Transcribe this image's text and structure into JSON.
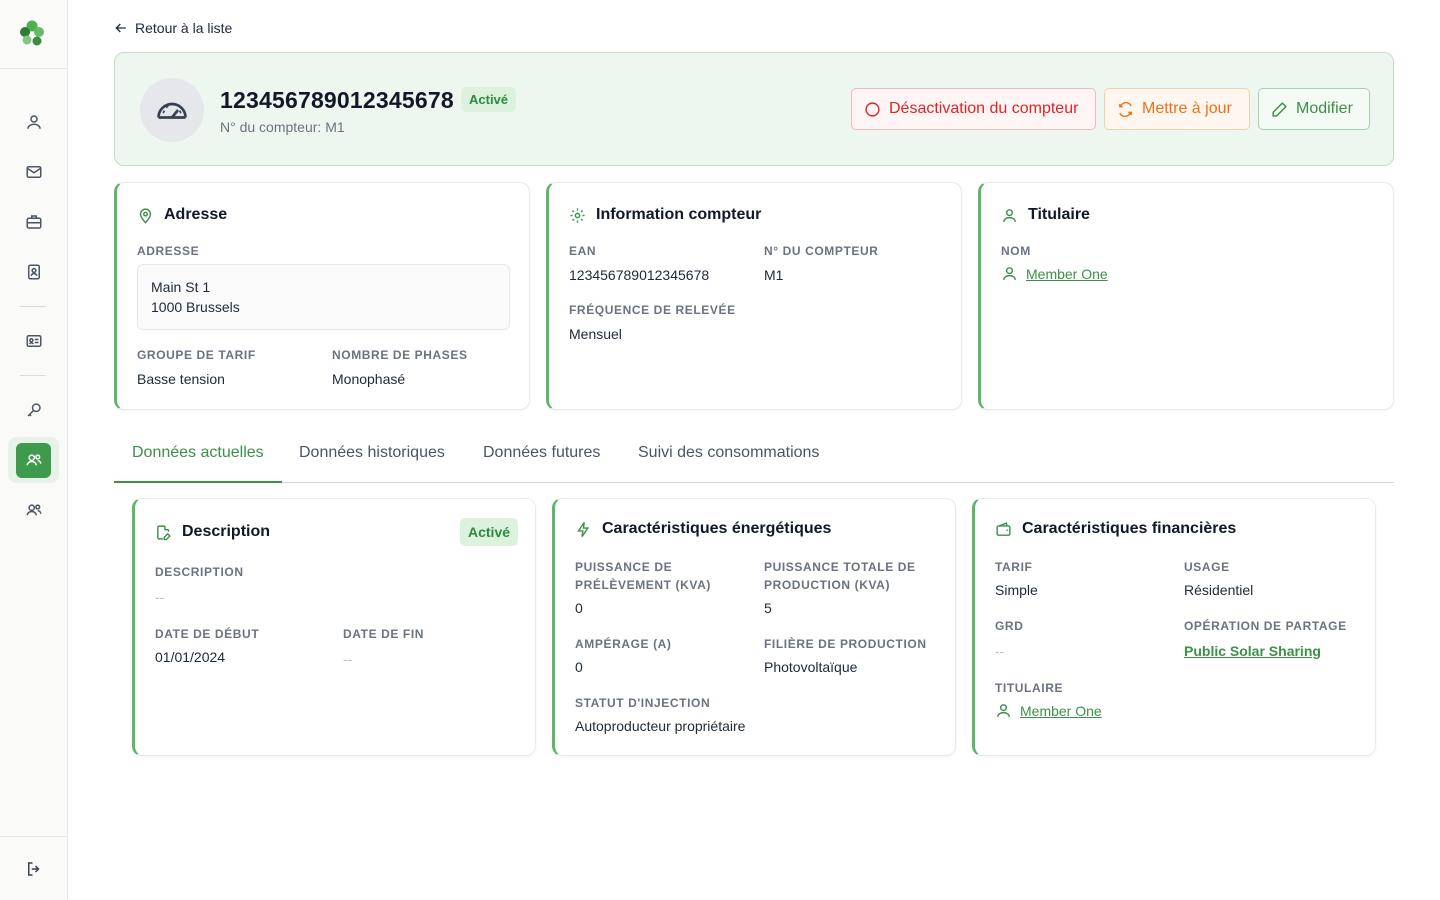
{
  "header": {
    "back_label": "Retour à la liste",
    "meter_id": "123456789012345678",
    "status_badge": "Activé",
    "subtitle": "N° du compteur: M1",
    "deactivate_label": "Désactivation du compteur",
    "update_label": "Mettre à jour",
    "edit_label": "Modifier"
  },
  "address_card": {
    "title": "Adresse",
    "address_label": "ADRESSE",
    "address_line1": "Main St 1",
    "address_line2": "1000 Brussels",
    "tariff_group_label": "GROUPE DE TARIF",
    "tariff_group_value": "Basse tension",
    "phases_label": "NOMBRE DE PHASES",
    "phases_value": "Monophasé"
  },
  "meter_card": {
    "title": "Information compteur",
    "ean_label": "EAN",
    "ean_value": "123456789012345678",
    "meter_no_label": "N° DU COMPTEUR",
    "meter_no_value": "M1",
    "frequency_label": "FRÉQUENCE DE RELEVÉE",
    "frequency_value": "Mensuel"
  },
  "holder_card": {
    "title": "Titulaire",
    "name_label": "NOM",
    "name_value": "Member One"
  },
  "tabs": [
    {
      "label": "Données actuelles"
    },
    {
      "label": "Données historiques"
    },
    {
      "label": "Données futures"
    },
    {
      "label": "Suivi des consommations"
    }
  ],
  "description_card": {
    "title": "Description",
    "badge": "Activé",
    "description_label": "DESCRIPTION",
    "description_value": "--",
    "start_label": "DATE DE DÉBUT",
    "start_value": "01/01/2024",
    "end_label": "DATE DE FIN",
    "end_value": "--"
  },
  "energy_card": {
    "title": "Caractéristiques énergétiques",
    "withdrawal_label_1": "PUISSANCE DE",
    "withdrawal_label_2": "PRÉLÈVEMENT (KVA)",
    "withdrawal_value": "0",
    "production_label_1": "PUISSANCE TOTALE DE",
    "production_label_2": "PRODUCTION (KVA)",
    "production_value": "5",
    "amperage_label": "AMPÉRAGE (A)",
    "amperage_value": "0",
    "sector_label": "FILIÈRE DE PRODUCTION",
    "sector_value": "Photovoltaïque",
    "injection_label": "STATUT D'INJECTION",
    "injection_value": "Autoproducteur propriétaire"
  },
  "finance_card": {
    "title": "Caractéristiques financières",
    "tariff_label": "TARIF",
    "tariff_value": "Simple",
    "usage_label": "USAGE",
    "usage_value": "Résidentiel",
    "grd_label": "GRD",
    "grd_value": "--",
    "sharing_label": "OPÉRATION DE PARTAGE",
    "sharing_value": "Public Solar Sharing",
    "holder_label": "TITULAIRE",
    "holder_value": "Member One"
  },
  "colors": {
    "accent": "#3d8f49",
    "danger": "#dc2626",
    "warning": "#ea7317"
  }
}
